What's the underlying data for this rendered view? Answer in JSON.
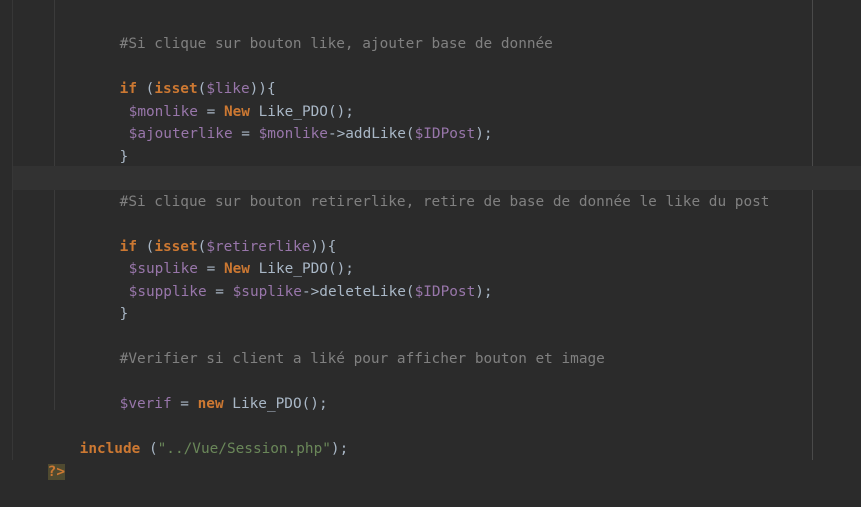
{
  "editor": {
    "language": "php",
    "lines": {
      "comment_like": "#Si clique sur bouton like, ajouter base de donnée",
      "if_like": {
        "kw": "if",
        "open": " (",
        "fn": "isset",
        "paren": "(",
        "var": "$like",
        "close": ")){"
      },
      "monlike": {
        "var": "$monlike",
        "eq": " = ",
        "kw": "New",
        "rest": " Like_PDO();"
      },
      "ajouterlike": {
        "var": "$ajouterlike",
        "eq": " = ",
        "var2": "$monlike",
        "call": "->addLike(",
        "arg": "$IDPost",
        "end": ");"
      },
      "brace1": "}",
      "comment_retirer": "#Si clique sur bouton retirerlike, retire de base de donnée le like du post",
      "if_retirer": {
        "kw": "if",
        "open": " (",
        "fn": "isset",
        "paren": "(",
        "var": "$retirerlike",
        "close": ")){"
      },
      "suplike": {
        "var": "$suplike",
        "eq": " = ",
        "kw": "New",
        "rest": " Like_PDO();"
      },
      "supplike": {
        "var": "$supplike",
        "eq": " = ",
        "var2": "$suplike",
        "call": "->deleteLike(",
        "arg": "$IDPost",
        "end": ");"
      },
      "brace2": "}",
      "comment_verifier": "#Verifier si client a liké pour afficher bouton et image",
      "verif": {
        "var": "$verif",
        "eq": " = ",
        "kw": "new",
        "rest": " Like_PDO();"
      },
      "include": {
        "kw": "include",
        "open": " (",
        "str": "\"../Vue/Session.php\"",
        "end": ");"
      },
      "php_close": "?>"
    }
  },
  "colors": {
    "background": "#2b2b2b",
    "comment": "#808080",
    "keyword": "#cc7832",
    "variable": "#9876aa",
    "string": "#6a8759",
    "text": "#a9b7c6"
  }
}
